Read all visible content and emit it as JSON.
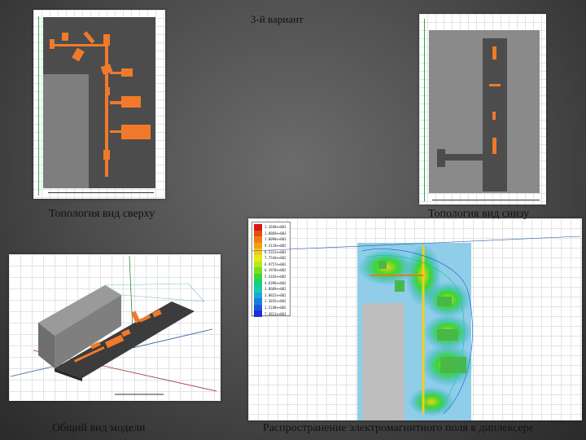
{
  "slide": {
    "title": "3-й вариант",
    "captions": {
      "top_view": "Топология вид сверху",
      "bottom_view": "Топология вид снизу",
      "model_view": "Общий вид модели",
      "field_view": "Распространение электромагнитного поля в диплексере"
    }
  },
  "colors": {
    "substrate": "#4c4c4c",
    "ground": "#7e7e7e",
    "copper": "#f07a2a",
    "field_bg": "#7ec8e8"
  },
  "field_legend": {
    "colors": [
      "#d81818",
      "#e84a10",
      "#f07a18",
      "#f0a018",
      "#f0c818",
      "#e8e818",
      "#b8e818",
      "#78e018",
      "#38d830",
      "#18d070",
      "#18c8b0",
      "#18a8d8",
      "#1880e0",
      "#1858e0",
      "#1830d8"
    ],
    "values": [
      "1.1648e+003",
      "1.0869e+003",
      "1.0090e+003",
      "9.3118e+002",
      "8.5331e+002",
      "7.7544e+002",
      "6.9757e+002",
      "6.1970e+002",
      "5.4183e+002",
      "4.6396e+002",
      "3.8609e+002",
      "3.0822e+002",
      "2.3035e+002",
      "1.5248e+002",
      "7.4611e+001"
    ]
  }
}
